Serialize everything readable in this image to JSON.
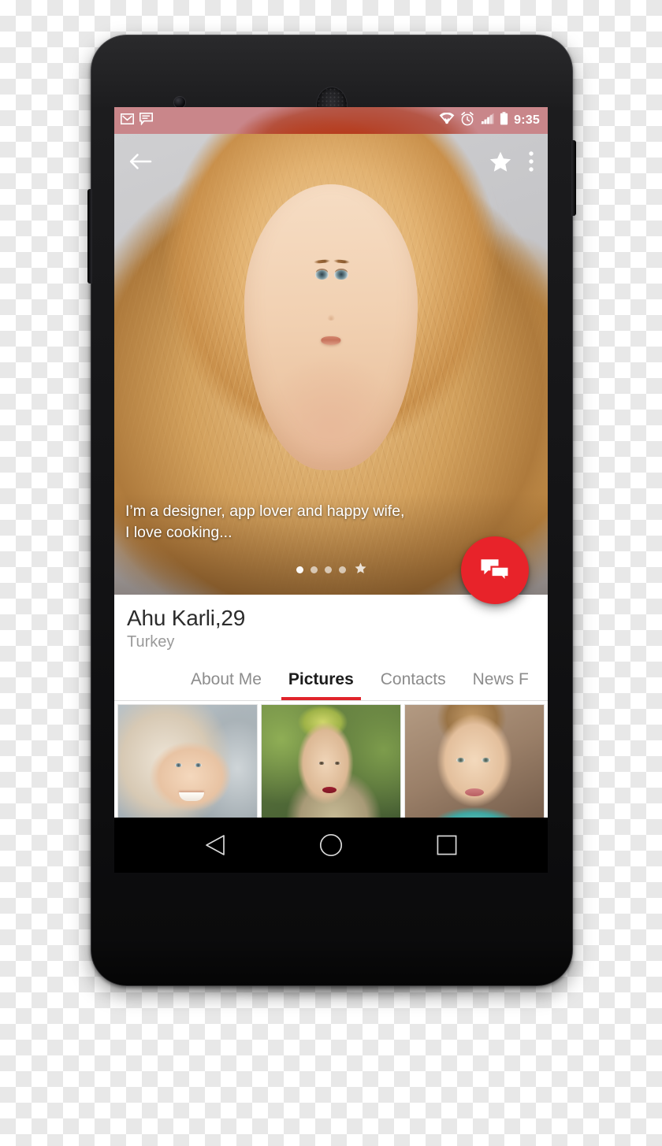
{
  "status_bar": {
    "left_icons": [
      {
        "name": "gmail-icon",
        "label": "Gmail"
      },
      {
        "name": "messages-icon",
        "label": "Messages"
      }
    ],
    "right_icons": [
      {
        "name": "wifi-icon",
        "label": "Wi-Fi"
      },
      {
        "name": "alarm-icon",
        "label": "Alarm"
      },
      {
        "name": "signal-icon",
        "label": "Signal"
      },
      {
        "name": "battery-icon",
        "label": "Battery"
      }
    ],
    "time": "9:35",
    "background_color": "#c9868a"
  },
  "app_bar": {
    "back_icon": "arrow-back-icon",
    "favorite_icon": "star-icon",
    "overflow_icon": "more-vert-icon"
  },
  "hero": {
    "bio_line_1": "I’m a designer, app lover and happy wife,",
    "bio_line_2": "I love cooking...",
    "page_indicator": {
      "total_dots": 4,
      "active_index": 0,
      "has_star": true
    }
  },
  "fab": {
    "name": "chat-fab",
    "icon": "chat-bubbles-icon",
    "color": "#e8232a"
  },
  "profile": {
    "name": "Ahu Karli,29",
    "location": "Turkey"
  },
  "tabs": {
    "items": [
      {
        "label": "About Me",
        "active": false
      },
      {
        "label": "Pictures",
        "active": true
      },
      {
        "label": "Contacts",
        "active": false
      },
      {
        "label": "News F",
        "active": false
      }
    ],
    "active_color": "#e0242b"
  },
  "photo_grid": {
    "tiles": [
      {
        "name": "photo-tile-1",
        "alt": "Smiling blonde woman portrait"
      },
      {
        "name": "photo-tile-2",
        "alt": "Woman outdoors in green setting"
      },
      {
        "name": "photo-tile-3",
        "alt": "Woman with turquoise necklace"
      }
    ]
  },
  "nav_bar": {
    "buttons": [
      {
        "name": "nav-back-button",
        "icon": "triangle-back-icon"
      },
      {
        "name": "nav-home-button",
        "icon": "circle-home-icon"
      },
      {
        "name": "nav-recents-button",
        "icon": "square-recents-icon"
      }
    ]
  }
}
